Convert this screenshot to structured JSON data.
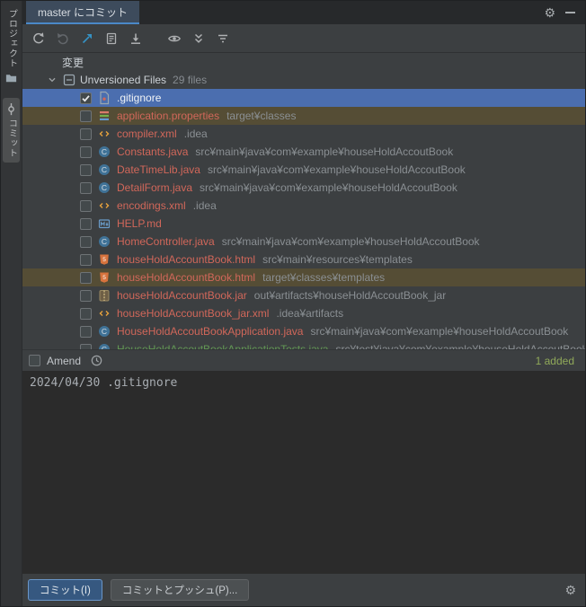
{
  "tab_bar": {
    "title": "master にコミット"
  },
  "sidebar": {
    "project_label": "プロジェクト",
    "commit_label": "コミット"
  },
  "toolbar": {
    "icons": [
      "refresh-icon",
      "rollback-icon",
      "shelve-silently-icon",
      "show-diff-icon",
      "save-to-shelf-icon",
      "preview-diff-icon",
      "expand-all-icon",
      "group-by-icon"
    ]
  },
  "tree": {
    "changes_label": "変更",
    "unversioned_label": "Unversioned Files",
    "unversioned_count": "29 files",
    "files": [
      {
        "name": ".gitignore",
        "path": "",
        "type": "gitignore",
        "checked": true,
        "highlight": "selected",
        "text_color": ""
      },
      {
        "name": "application.properties",
        "path": "target¥classes",
        "type": "properties",
        "checked": false,
        "highlight": "stale",
        "text_color": ""
      },
      {
        "name": "compiler.xml",
        "path": ".idea",
        "type": "xml",
        "checked": false,
        "highlight": "",
        "text_color": ""
      },
      {
        "name": "Constants.java",
        "path": "src¥main¥java¥com¥example¥houseHoldAccoutBook",
        "type": "java",
        "checked": false,
        "highlight": "",
        "text_color": ""
      },
      {
        "name": "DateTimeLib.java",
        "path": "src¥main¥java¥com¥example¥houseHoldAccoutBook",
        "type": "java",
        "checked": false,
        "highlight": "",
        "text_color": ""
      },
      {
        "name": "DetailForm.java",
        "path": "src¥main¥java¥com¥example¥houseHoldAccoutBook",
        "type": "java",
        "checked": false,
        "highlight": "",
        "text_color": ""
      },
      {
        "name": "encodings.xml",
        "path": ".idea",
        "type": "xml",
        "checked": false,
        "highlight": "",
        "text_color": ""
      },
      {
        "name": "HELP.md",
        "path": "",
        "type": "markdown",
        "checked": false,
        "highlight": "",
        "text_color": ""
      },
      {
        "name": "HomeController.java",
        "path": "src¥main¥java¥com¥example¥houseHoldAccoutBook",
        "type": "java",
        "checked": false,
        "highlight": "",
        "text_color": ""
      },
      {
        "name": "houseHoldAccountBook.html",
        "path": "src¥main¥resources¥templates",
        "type": "html",
        "checked": false,
        "highlight": "",
        "text_color": ""
      },
      {
        "name": "houseHoldAccountBook.html",
        "path": "target¥classes¥templates",
        "type": "html",
        "checked": false,
        "highlight": "stale",
        "text_color": ""
      },
      {
        "name": "houseHoldAccountBook.jar",
        "path": "out¥artifacts¥houseHoldAccoutBook_jar",
        "type": "jar",
        "checked": false,
        "highlight": "",
        "text_color": ""
      },
      {
        "name": "houseHoldAccountBook_jar.xml",
        "path": ".idea¥artifacts",
        "type": "xml",
        "checked": false,
        "highlight": "",
        "text_color": ""
      },
      {
        "name": "HouseHoldAccoutBookApplication.java",
        "path": "src¥main¥java¥com¥example¥houseHoldAccoutBook",
        "type": "java",
        "checked": false,
        "highlight": "",
        "text_color": ""
      },
      {
        "name": "HouseHoldAccoutBookApplicationTests.java",
        "path": "src¥test¥java¥com¥example¥houseHoldAccoutBook",
        "type": "java",
        "checked": false,
        "highlight": "",
        "text_color": "green"
      }
    ]
  },
  "amend": {
    "label": "Amend",
    "added_label": "1 added"
  },
  "message": {
    "text": "2024/04/30 .gitignore"
  },
  "footer": {
    "commit_label": "コミット(I)",
    "commit_push_label": "コミットとプッシュ(P)..."
  },
  "colors": {
    "selection_bg": "#4b6eaf",
    "stale_row_bg": "#554d35",
    "unversioned_text": "#d1675a",
    "added_text": "#90a959",
    "primary_button_bg": "#365880"
  }
}
